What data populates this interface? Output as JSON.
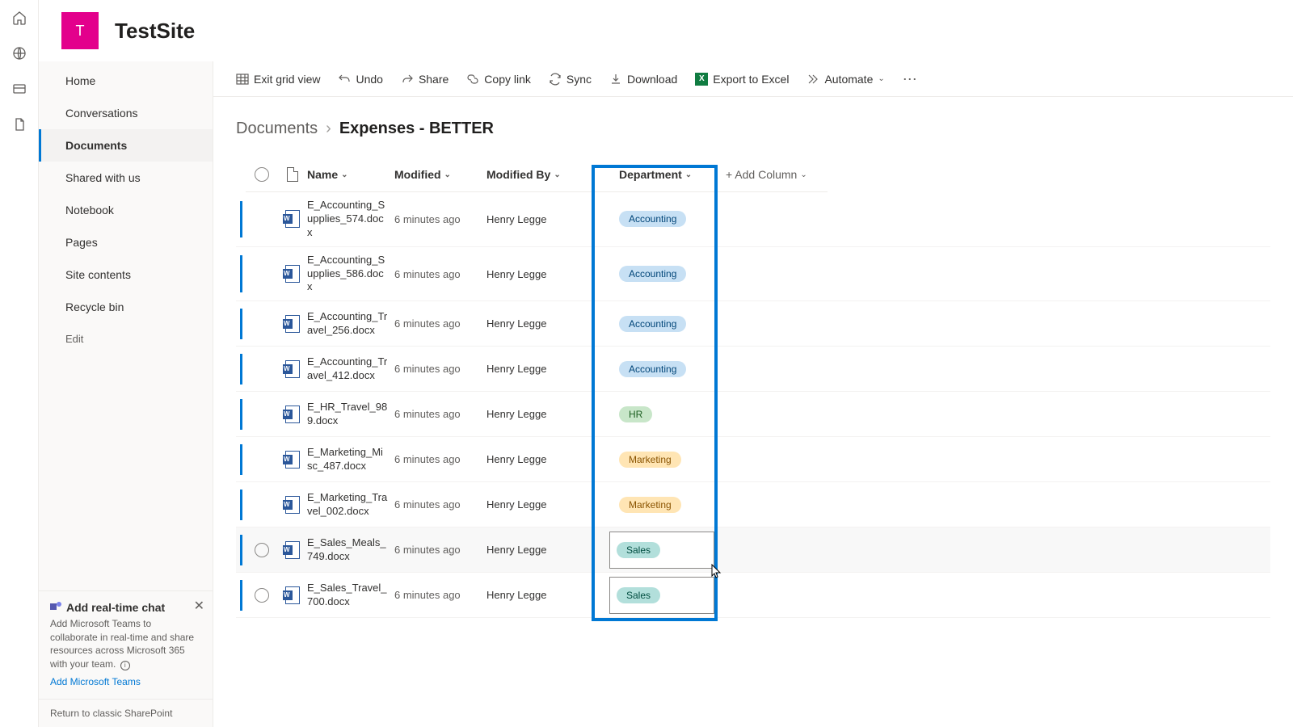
{
  "site": {
    "logo_letter": "T",
    "title": "TestSite"
  },
  "rail": {
    "items": [
      "home",
      "globe",
      "card",
      "file"
    ]
  },
  "nav": {
    "items": [
      {
        "label": "Home"
      },
      {
        "label": "Conversations"
      },
      {
        "label": "Documents",
        "active": true
      },
      {
        "label": "Shared with us"
      },
      {
        "label": "Notebook"
      },
      {
        "label": "Pages"
      },
      {
        "label": "Site contents"
      },
      {
        "label": "Recycle bin"
      }
    ],
    "edit_label": "Edit"
  },
  "promo": {
    "title": "Add real-time chat",
    "body": "Add Microsoft Teams to collaborate in real-time and share resources across Microsoft 365 with your team.",
    "link": "Add Microsoft Teams"
  },
  "return_link": "Return to classic SharePoint",
  "commands": {
    "exit_grid": "Exit grid view",
    "undo": "Undo",
    "share": "Share",
    "copy_link": "Copy link",
    "sync": "Sync",
    "download": "Download",
    "export_excel": "Export to Excel",
    "automate": "Automate"
  },
  "breadcrumb": {
    "root": "Documents",
    "current": "Expenses - BETTER"
  },
  "columns": {
    "name": "Name",
    "modified": "Modified",
    "modified_by": "Modified By",
    "department": "Department",
    "add": "+ Add Column"
  },
  "rows": [
    {
      "name": "E_Accounting_Supplies_574.docx",
      "modified": "6 minutes ago",
      "modified_by": "Henry Legge",
      "dept": "Accounting",
      "dept_class": "accounting"
    },
    {
      "name": "E_Accounting_Supplies_586.docx",
      "modified": "6 minutes ago",
      "modified_by": "Henry Legge",
      "dept": "Accounting",
      "dept_class": "accounting"
    },
    {
      "name": "E_Accounting_Travel_256.docx",
      "modified": "6 minutes ago",
      "modified_by": "Henry Legge",
      "dept": "Accounting",
      "dept_class": "accounting"
    },
    {
      "name": "E_Accounting_Travel_412.docx",
      "modified": "6 minutes ago",
      "modified_by": "Henry Legge",
      "dept": "Accounting",
      "dept_class": "accounting"
    },
    {
      "name": "E_HR_Travel_989.docx",
      "modified": "6 minutes ago",
      "modified_by": "Henry Legge",
      "dept": "HR",
      "dept_class": "hr"
    },
    {
      "name": "E_Marketing_Misc_487.docx",
      "modified": "6 minutes ago",
      "modified_by": "Henry Legge",
      "dept": "Marketing",
      "dept_class": "marketing"
    },
    {
      "name": "E_Marketing_Travel_002.docx",
      "modified": "6 minutes ago",
      "modified_by": "Henry Legge",
      "dept": "Marketing",
      "dept_class": "marketing"
    },
    {
      "name": "E_Sales_Meals_749.docx",
      "modified": "6 minutes ago",
      "modified_by": "Henry Legge",
      "dept": "Sales",
      "dept_class": "sales",
      "hover": true,
      "editing": true,
      "show_sel": true
    },
    {
      "name": "E_Sales_Travel_700.docx",
      "modified": "6 minutes ago",
      "modified_by": "Henry Legge",
      "dept": "Sales",
      "dept_class": "sales",
      "editing": true,
      "show_sel": true
    }
  ]
}
